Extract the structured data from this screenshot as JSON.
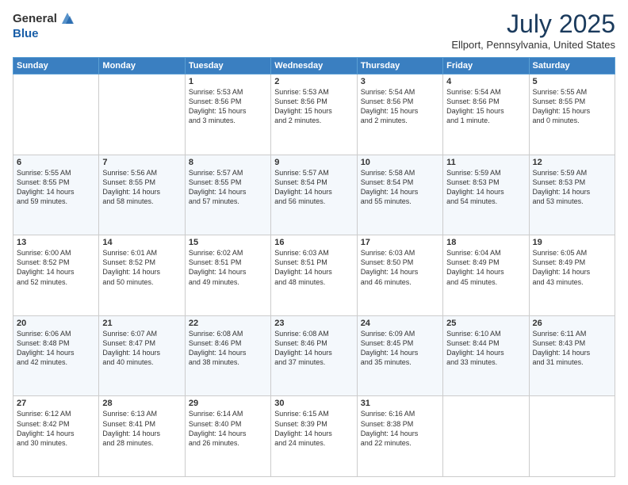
{
  "header": {
    "logo_general": "General",
    "logo_blue": "Blue",
    "title": "July 2025",
    "subtitle": "Ellport, Pennsylvania, United States"
  },
  "days_of_week": [
    "Sunday",
    "Monday",
    "Tuesday",
    "Wednesday",
    "Thursday",
    "Friday",
    "Saturday"
  ],
  "weeks": [
    [
      {
        "day": "",
        "info": ""
      },
      {
        "day": "",
        "info": ""
      },
      {
        "day": "1",
        "info": "Sunrise: 5:53 AM\nSunset: 8:56 PM\nDaylight: 15 hours\nand 3 minutes."
      },
      {
        "day": "2",
        "info": "Sunrise: 5:53 AM\nSunset: 8:56 PM\nDaylight: 15 hours\nand 2 minutes."
      },
      {
        "day": "3",
        "info": "Sunrise: 5:54 AM\nSunset: 8:56 PM\nDaylight: 15 hours\nand 2 minutes."
      },
      {
        "day": "4",
        "info": "Sunrise: 5:54 AM\nSunset: 8:56 PM\nDaylight: 15 hours\nand 1 minute."
      },
      {
        "day": "5",
        "info": "Sunrise: 5:55 AM\nSunset: 8:55 PM\nDaylight: 15 hours\nand 0 minutes."
      }
    ],
    [
      {
        "day": "6",
        "info": "Sunrise: 5:55 AM\nSunset: 8:55 PM\nDaylight: 14 hours\nand 59 minutes."
      },
      {
        "day": "7",
        "info": "Sunrise: 5:56 AM\nSunset: 8:55 PM\nDaylight: 14 hours\nand 58 minutes."
      },
      {
        "day": "8",
        "info": "Sunrise: 5:57 AM\nSunset: 8:55 PM\nDaylight: 14 hours\nand 57 minutes."
      },
      {
        "day": "9",
        "info": "Sunrise: 5:57 AM\nSunset: 8:54 PM\nDaylight: 14 hours\nand 56 minutes."
      },
      {
        "day": "10",
        "info": "Sunrise: 5:58 AM\nSunset: 8:54 PM\nDaylight: 14 hours\nand 55 minutes."
      },
      {
        "day": "11",
        "info": "Sunrise: 5:59 AM\nSunset: 8:53 PM\nDaylight: 14 hours\nand 54 minutes."
      },
      {
        "day": "12",
        "info": "Sunrise: 5:59 AM\nSunset: 8:53 PM\nDaylight: 14 hours\nand 53 minutes."
      }
    ],
    [
      {
        "day": "13",
        "info": "Sunrise: 6:00 AM\nSunset: 8:52 PM\nDaylight: 14 hours\nand 52 minutes."
      },
      {
        "day": "14",
        "info": "Sunrise: 6:01 AM\nSunset: 8:52 PM\nDaylight: 14 hours\nand 50 minutes."
      },
      {
        "day": "15",
        "info": "Sunrise: 6:02 AM\nSunset: 8:51 PM\nDaylight: 14 hours\nand 49 minutes."
      },
      {
        "day": "16",
        "info": "Sunrise: 6:03 AM\nSunset: 8:51 PM\nDaylight: 14 hours\nand 48 minutes."
      },
      {
        "day": "17",
        "info": "Sunrise: 6:03 AM\nSunset: 8:50 PM\nDaylight: 14 hours\nand 46 minutes."
      },
      {
        "day": "18",
        "info": "Sunrise: 6:04 AM\nSunset: 8:49 PM\nDaylight: 14 hours\nand 45 minutes."
      },
      {
        "day": "19",
        "info": "Sunrise: 6:05 AM\nSunset: 8:49 PM\nDaylight: 14 hours\nand 43 minutes."
      }
    ],
    [
      {
        "day": "20",
        "info": "Sunrise: 6:06 AM\nSunset: 8:48 PM\nDaylight: 14 hours\nand 42 minutes."
      },
      {
        "day": "21",
        "info": "Sunrise: 6:07 AM\nSunset: 8:47 PM\nDaylight: 14 hours\nand 40 minutes."
      },
      {
        "day": "22",
        "info": "Sunrise: 6:08 AM\nSunset: 8:46 PM\nDaylight: 14 hours\nand 38 minutes."
      },
      {
        "day": "23",
        "info": "Sunrise: 6:08 AM\nSunset: 8:46 PM\nDaylight: 14 hours\nand 37 minutes."
      },
      {
        "day": "24",
        "info": "Sunrise: 6:09 AM\nSunset: 8:45 PM\nDaylight: 14 hours\nand 35 minutes."
      },
      {
        "day": "25",
        "info": "Sunrise: 6:10 AM\nSunset: 8:44 PM\nDaylight: 14 hours\nand 33 minutes."
      },
      {
        "day": "26",
        "info": "Sunrise: 6:11 AM\nSunset: 8:43 PM\nDaylight: 14 hours\nand 31 minutes."
      }
    ],
    [
      {
        "day": "27",
        "info": "Sunrise: 6:12 AM\nSunset: 8:42 PM\nDaylight: 14 hours\nand 30 minutes."
      },
      {
        "day": "28",
        "info": "Sunrise: 6:13 AM\nSunset: 8:41 PM\nDaylight: 14 hours\nand 28 minutes."
      },
      {
        "day": "29",
        "info": "Sunrise: 6:14 AM\nSunset: 8:40 PM\nDaylight: 14 hours\nand 26 minutes."
      },
      {
        "day": "30",
        "info": "Sunrise: 6:15 AM\nSunset: 8:39 PM\nDaylight: 14 hours\nand 24 minutes."
      },
      {
        "day": "31",
        "info": "Sunrise: 6:16 AM\nSunset: 8:38 PM\nDaylight: 14 hours\nand 22 minutes."
      },
      {
        "day": "",
        "info": ""
      },
      {
        "day": "",
        "info": ""
      }
    ]
  ]
}
